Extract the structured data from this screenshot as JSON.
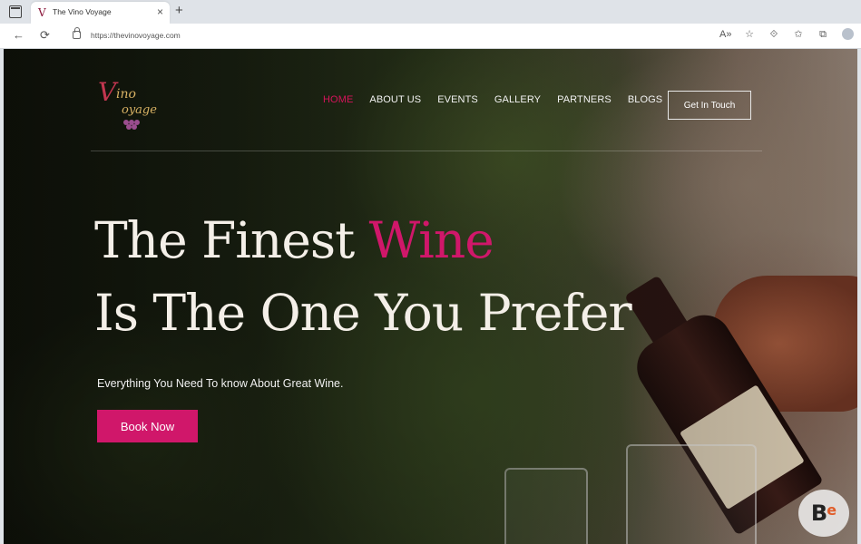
{
  "browser": {
    "tab_title": "The Vino Voyage",
    "tab_close": "×",
    "new_tab": "+",
    "url": "https://thevinovoyage.com",
    "back": "←",
    "reload": "⟳",
    "toolbar_icons": [
      "read-aloud-icon",
      "favorites-add-icon",
      "extensions-icon",
      "favorites-icon",
      "collections-icon",
      "profile-icon"
    ]
  },
  "site": {
    "logo": {
      "line1": "ino",
      "line2": "oyage"
    },
    "nav": [
      "HOME",
      "ABOUT US",
      "EVENTS",
      "GALLERY",
      "PARTNERS",
      "BLOGS"
    ],
    "active_nav": "HOME",
    "cta": "Get In Touch",
    "hero": {
      "line1_a": "The Finest ",
      "line1_b": "Wine",
      "line2": "Is The One You Prefer",
      "subtitle": "Everything You Need To know About Great Wine.",
      "button": "Book Now"
    },
    "watermark": "Be",
    "colors": {
      "accent": "#d0176a",
      "text": "#f4efe8"
    }
  }
}
